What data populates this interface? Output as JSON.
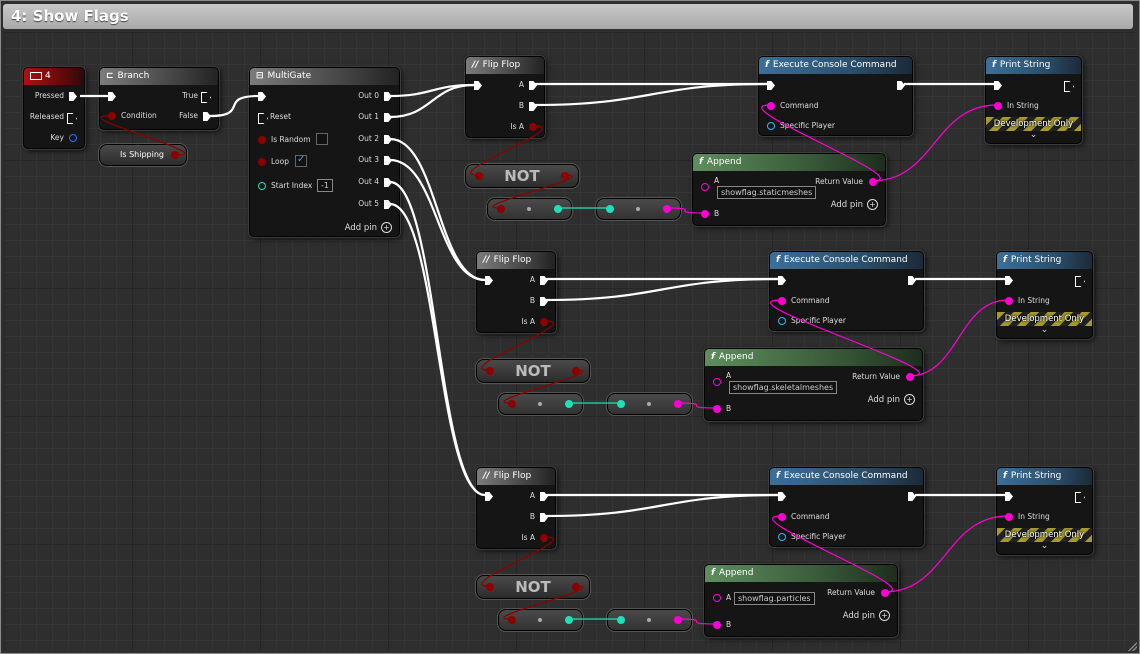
{
  "comment_box": {
    "title": "4: Show Flags"
  },
  "colors": {
    "exec": "#ffffff",
    "bool": "#8c0000",
    "string": "#ff00d4",
    "object": "#2fb7ff",
    "int": "#1fe0b8"
  },
  "key_event": {
    "title": "4",
    "pressed": "Pressed",
    "released": "Released",
    "key": "Key"
  },
  "branch": {
    "title": "Branch",
    "condition": "Condition",
    "true": "True",
    "false": "False"
  },
  "is_shipping": {
    "label": "Is Shipping"
  },
  "multigate": {
    "title": "MultiGate",
    "reset": "Reset",
    "is_random": "Is Random",
    "loop": "Loop",
    "start_index": "Start Index",
    "start_index_value": "-1",
    "add_pin": "Add pin",
    "outputs": [
      "Out 0",
      "Out 1",
      "Out 2",
      "Out 3",
      "Out 4",
      "Out 5"
    ]
  },
  "groups": [
    {
      "flipflop": {
        "title": "Flip Flop",
        "a": "A",
        "b": "B",
        "is_a": "Is A"
      },
      "not": "NOT",
      "exec_cmd": {
        "title": "Execute Console Command",
        "command": "Command",
        "player": "Specific Player"
      },
      "print": {
        "title": "Print String",
        "in_string": "In String",
        "dev": "Development Only"
      },
      "append": {
        "title": "Append",
        "a": "A",
        "a_value": "showflag.staticmeshes",
        "b": "B",
        "ret": "Return Value",
        "add_pin": "Add pin"
      }
    },
    {
      "flipflop": {
        "title": "Flip Flop",
        "a": "A",
        "b": "B",
        "is_a": "Is A"
      },
      "not": "NOT",
      "exec_cmd": {
        "title": "Execute Console Command",
        "command": "Command",
        "player": "Specific Player"
      },
      "print": {
        "title": "Print String",
        "in_string": "In String",
        "dev": "Development Only"
      },
      "append": {
        "title": "Append",
        "a": "A",
        "a_value": "showflag.skeletalmeshes",
        "b": "B",
        "ret": "Return Value",
        "add_pin": "Add pin"
      }
    },
    {
      "flipflop": {
        "title": "Flip Flop",
        "a": "A",
        "b": "B",
        "is_a": "Is A"
      },
      "not": "NOT",
      "exec_cmd": {
        "title": "Execute Console Command",
        "command": "Command",
        "player": "Specific Player"
      },
      "print": {
        "title": "Print String",
        "in_string": "In String",
        "dev": "Development Only"
      },
      "append": {
        "title": "Append",
        "a": "A",
        "a_value": "showflag.particles",
        "b": "B",
        "ret": "Return Value",
        "add_pin": "Add pin"
      }
    }
  ]
}
